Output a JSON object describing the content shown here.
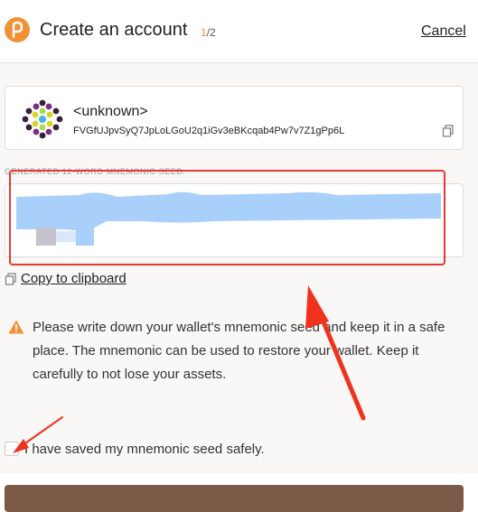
{
  "header": {
    "title": "Create an account",
    "step_current": "1",
    "step_total": "/2",
    "cancel_label": "Cancel",
    "logo_icon": "polkadot-logo-icon",
    "logo_color": "#f19135"
  },
  "account": {
    "name": "<unknown>",
    "address": "FVGfUJpvSyQ7JpLoLGoU2q1iGv3eBKcqab4Pw7v7Z1gPp6L",
    "avatar_icon": "identicon",
    "copy_icon": "copy-icon"
  },
  "seed": {
    "label": "GENERATED 12-WORD MNEMONIC SEED:",
    "redaction_color": "#a9d0fb",
    "highlight_color": "#e53935"
  },
  "copy_clipboard": {
    "label": "Copy to clipboard",
    "icon": "copy-icon"
  },
  "warning": {
    "icon": "warning-icon",
    "color": "#f19135",
    "text": "Please write down your wallet's mnemonic seed and keep it in a safe place. The mnemonic can be used to restore your wallet. Keep it carefully to not lose your assets."
  },
  "confirm": {
    "label": "I have saved my mnemonic seed safely.",
    "checked": false
  },
  "footer": {
    "button_color": "#7b5a47"
  },
  "annotations": {
    "arrow_color": "#f0321e"
  }
}
